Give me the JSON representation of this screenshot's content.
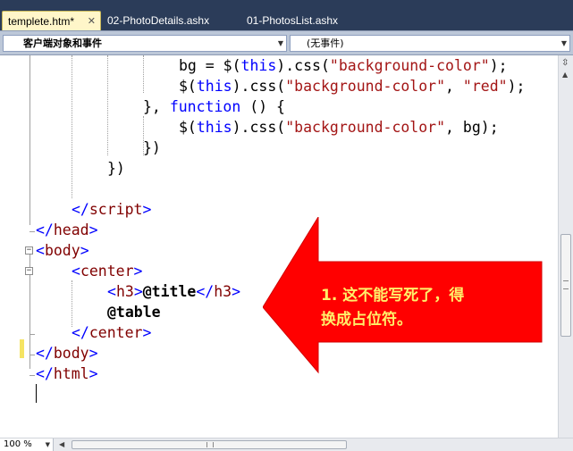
{
  "tabs": [
    {
      "label": "templete.htm*",
      "active": true
    },
    {
      "label": "02-PhotoDetails.ashx",
      "active": false
    },
    {
      "label": "01-PhotosList.ashx",
      "active": false
    }
  ],
  "dropdowns": {
    "object_selector": "客户端对象和事件",
    "event_selector": "(无事件)"
  },
  "code_lines": {
    "l1": {
      "a": "bg = $(",
      "b": "this",
      "c": ").css(",
      "d": "\"background-color\"",
      "e": ");"
    },
    "l2": {
      "a": "$(",
      "b": "this",
      "c": ").css(",
      "d": "\"background-color\"",
      "e": ", ",
      "f": "\"red\"",
      "g": ");"
    },
    "l3": {
      "a": "}, ",
      "b": "function",
      "c": " () {"
    },
    "l4": {
      "a": "$(",
      "b": "this",
      "c": ").css(",
      "d": "\"background-color\"",
      "e": ", bg);"
    },
    "l5": "})",
    "l6": "})",
    "l7": {
      "o": "</",
      "t": "script",
      "c": ">"
    },
    "l8": {
      "o": "</",
      "t": "head",
      "c": ">"
    },
    "l9": {
      "o": "<",
      "t": "body",
      "c": ">"
    },
    "l10": {
      "o": "<",
      "t": "center",
      "c": ">"
    },
    "l11": {
      "o": "<",
      "t": "h3",
      "c": ">",
      "v": "@title",
      "o2": "</",
      "t2": "h3",
      "c2": ">"
    },
    "l12": "@table",
    "l13": {
      "o": "</",
      "t": "center",
      "c": ">"
    },
    "l14": {
      "o": "</",
      "t": "body",
      "c": ">"
    },
    "l15": {
      "o": "</",
      "t": "html",
      "c": ">"
    }
  },
  "annotation": {
    "line1": "1. 这不能写死了，得",
    "line2": "换成占位符。",
    "arrow_color": "#ff0000",
    "text_color": "#ffef6a"
  },
  "zoom": "100 %",
  "colors": {
    "tabbar": "#2b3c59",
    "active_tab": "#fff6c9",
    "keyword": "#0000ff",
    "string": "#a31515",
    "tag": "#800000"
  }
}
